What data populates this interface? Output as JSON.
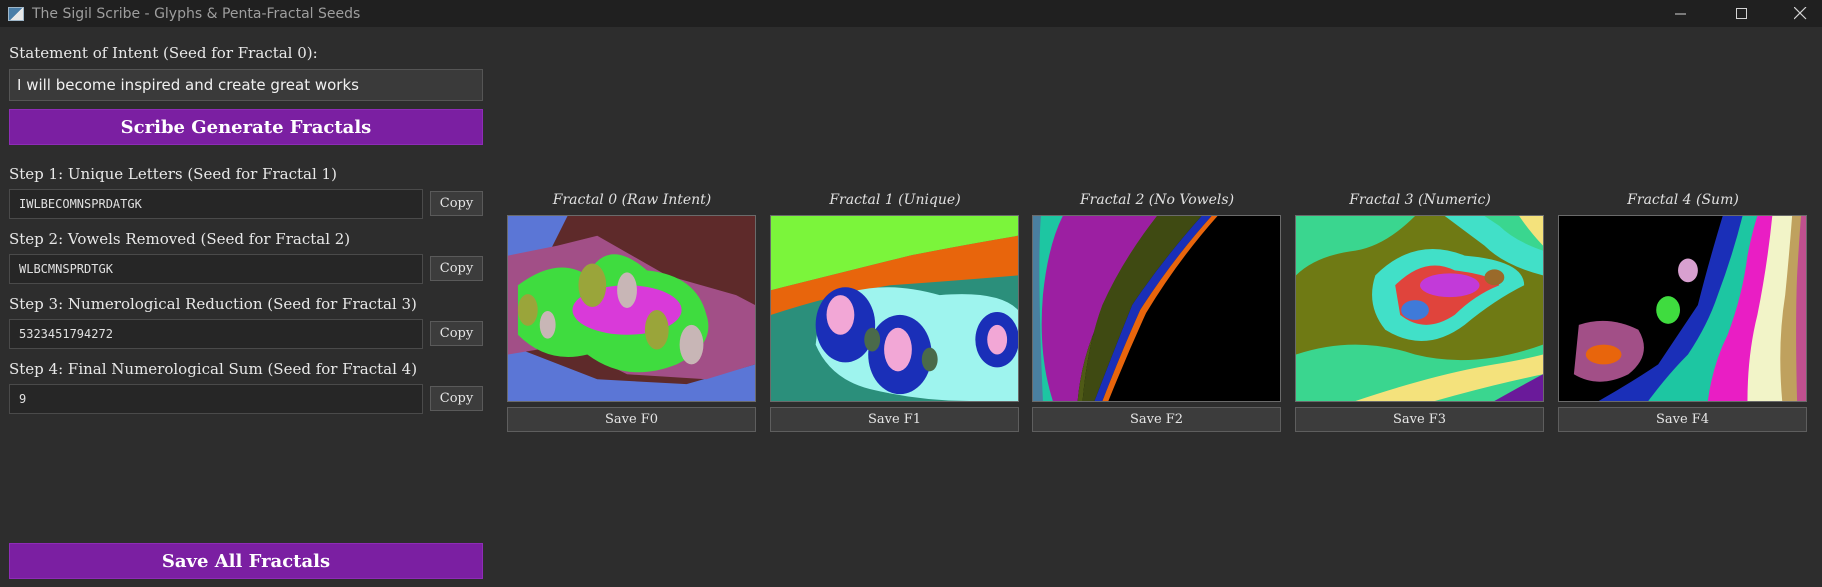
{
  "window": {
    "title": "The Sigil Scribe - Glyphs & Penta-Fractal Seeds",
    "icons": [
      "app-icon",
      "minimize-icon",
      "maximize-icon",
      "close-icon"
    ]
  },
  "intent": {
    "label": "Statement of Intent (Seed for Fractal 0):",
    "value": "I will become inspired and create great works"
  },
  "scribe_button": "Scribe  Generate Fractals",
  "steps": [
    {
      "label": "Step 1: Unique Letters (Seed for Fractal 1)",
      "value": "IWLBECOMNSPRDATGK",
      "copy": "Copy"
    },
    {
      "label": "Step 2: Vowels Removed (Seed for Fractal 2)",
      "value": "WLBCMNSPRDTGK",
      "copy": "Copy"
    },
    {
      "label": "Step 3: Numerological Reduction (Seed for Fractal 3)",
      "value": "5323451794272",
      "copy": "Copy"
    },
    {
      "label": "Step 4: Final Numerological Sum (Seed for Fractal 4)",
      "value": "9",
      "copy": "Copy"
    }
  ],
  "save_all_button": "Save All Fractals",
  "fractals": [
    {
      "title": "Fractal 0 (Raw Intent)",
      "save": "Save F0"
    },
    {
      "title": "Fractal 1 (Unique)",
      "save": "Save F1"
    },
    {
      "title": "Fractal 2 (No Vowels)",
      "save": "Save F2"
    },
    {
      "title": "Fractal 3 (Numeric)",
      "save": "Save F3"
    },
    {
      "title": "Fractal 4 (Sum)",
      "save": "Save F4"
    }
  ],
  "colors": {
    "accent": "#7b1fa2",
    "background": "#2d2d2d",
    "titlebar": "#202020"
  }
}
